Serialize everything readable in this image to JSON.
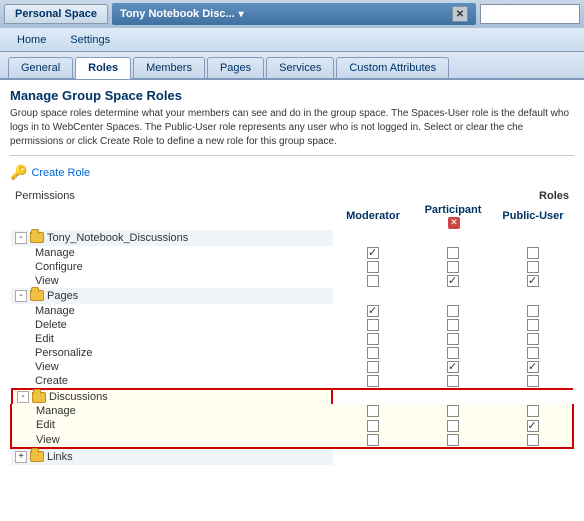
{
  "titleBar": {
    "tabLabel": "Personal Space",
    "windowTitle": "Tony Notebook Disc...",
    "closeLabel": "✕",
    "dropdownArrow": "▾"
  },
  "navBar": {
    "homeLabel": "Home",
    "settingsLabel": "Settings"
  },
  "tabs": [
    {
      "id": "general",
      "label": "General"
    },
    {
      "id": "roles",
      "label": "Roles",
      "active": true
    },
    {
      "id": "members",
      "label": "Members"
    },
    {
      "id": "pages",
      "label": "Pages"
    },
    {
      "id": "services",
      "label": "Services"
    },
    {
      "id": "customattributes",
      "label": "Custom Attributes"
    }
  ],
  "content": {
    "sectionTitle": "Manage Group Space Roles",
    "description": "Group space roles determine what your members can see and do in the group space. The Spaces-User role is the default who logs in to WebCenter Spaces. The Public-User role represents any user who is not logged in. Select or clear the che permissions or click Create Role to define a new role for this group space.",
    "createRoleLabel": "Create Role",
    "rolesHeader": "Roles",
    "permissionsHeader": "Permissions",
    "columns": {
      "moderator": "Moderator",
      "participant": "Participant",
      "participantClose": "✕",
      "publicUser": "Public-User"
    },
    "groups": [
      {
        "id": "tony_notebook",
        "name": "Tony_Notebook_Discussions",
        "expanded": true,
        "rows": [
          {
            "label": "Manage",
            "moderator": true,
            "participant": false,
            "publicUser": false
          },
          {
            "label": "Configure",
            "moderator": false,
            "participant": false,
            "publicUser": false
          },
          {
            "label": "View",
            "moderator": false,
            "participant": true,
            "publicUser": true
          }
        ]
      },
      {
        "id": "pages",
        "name": "Pages",
        "expanded": true,
        "rows": [
          {
            "label": "Manage",
            "moderator": true,
            "participant": false,
            "publicUser": false
          },
          {
            "label": "Delete",
            "moderator": false,
            "participant": false,
            "publicUser": false
          },
          {
            "label": "Edit",
            "moderator": false,
            "participant": false,
            "publicUser": false
          },
          {
            "label": "Personalize",
            "moderator": false,
            "participant": false,
            "publicUser": false
          },
          {
            "label": "View",
            "moderator": false,
            "participant": true,
            "publicUser": true
          },
          {
            "label": "Create",
            "moderator": false,
            "participant": false,
            "publicUser": false
          }
        ]
      },
      {
        "id": "discussions",
        "name": "Discussions",
        "highlighted": true,
        "expanded": true,
        "rows": [
          {
            "label": "Manage",
            "moderator": false,
            "participant": false,
            "publicUser": false
          },
          {
            "label": "Edit",
            "moderator": false,
            "participant": false,
            "publicUser": true
          },
          {
            "label": "View",
            "moderator": false,
            "participant": false,
            "publicUser": false
          }
        ]
      },
      {
        "id": "links",
        "name": "Links",
        "expanded": false,
        "rows": []
      }
    ]
  }
}
